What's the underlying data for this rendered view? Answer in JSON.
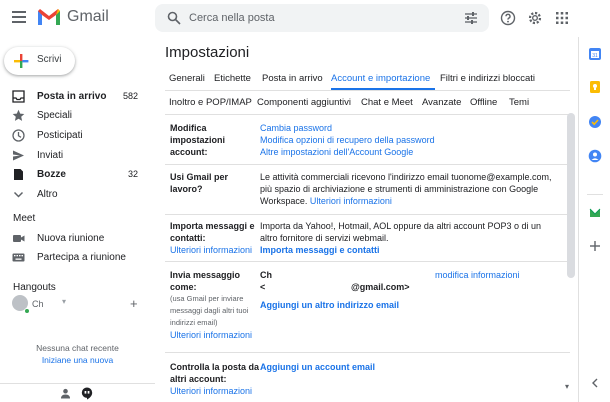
{
  "app": {
    "name": "Gmail",
    "search_placeholder": "Cerca nella posta"
  },
  "sidebar": {
    "compose_label": "Scrivi",
    "items": [
      {
        "label": "Posta in arrivo",
        "count": "582",
        "icon": "inbox-icon",
        "bold": true
      },
      {
        "label": "Speciali",
        "count": "",
        "icon": "star-icon",
        "bold": false
      },
      {
        "label": "Posticipati",
        "count": "",
        "icon": "clock-icon",
        "bold": false
      },
      {
        "label": "Inviati",
        "count": "",
        "icon": "send-icon",
        "bold": false
      },
      {
        "label": "Bozze",
        "count": "32",
        "icon": "draft-icon",
        "bold": true
      },
      {
        "label": "Altro",
        "count": "",
        "icon": "chevron-down-icon",
        "bold": false
      }
    ],
    "meet": {
      "title": "Meet",
      "items": [
        {
          "label": "Nuova riunione",
          "icon": "video-icon"
        },
        {
          "label": "Partecipa a riunione",
          "icon": "keyboard-icon"
        }
      ]
    },
    "hangouts": {
      "title": "Hangouts",
      "user_name": "Ch",
      "no_chat": "Nessuna chat recente",
      "start_new": "Iniziane una nuova"
    }
  },
  "settings": {
    "title": "Impostazioni",
    "tabs_row1": [
      "Generali",
      "Etichette",
      "Posta in arrivo",
      "Account e importazione",
      "Filtri e indirizzi bloccati"
    ],
    "tabs_row2": [
      "Inoltro e POP/IMAP",
      "Componenti aggiuntivi",
      "Chat e Meet",
      "Avanzate",
      "Offline",
      "Temi"
    ],
    "active_tab": "Account e importazione",
    "rows": {
      "change_account": {
        "label": "Modifica impostazioni account:",
        "links": [
          "Cambia password",
          "Modifica opzioni di recupero della password",
          "Altre impostazioni dell'Account Google"
        ]
      },
      "work": {
        "label": "Usi Gmail per lavoro?",
        "text": "Le attività commerciali ricevono l'indirizzo email tuonome@example.com, più spazio di archiviazione e strumenti di amministrazione con Google Workspace.",
        "more": "Ulteriori informazioni"
      },
      "import": {
        "label": "Importa messaggi e contatti:",
        "more": "Ulteriori informazioni",
        "text": "Importa da Yahoo!, Hotmail, AOL oppure da altri account POP3 o di un altro fornitore di servizi webmail.",
        "action": "Importa messaggi e contatti"
      },
      "send_as": {
        "label": "Invia messaggio come:",
        "note": "(usa Gmail per inviare messaggi dagli altri tuoi indirizzi email)",
        "more": "Ulteriori informazioni",
        "name_line": "Ch",
        "email_line": "<",
        "email_domain": "@gmail.com>",
        "edit": "modifica informazioni",
        "add": "Aggiungi un altro indirizzo email"
      },
      "check_mail": {
        "label": "Controlla la posta da altri account:",
        "more": "Ulteriori informazioni",
        "add": "Aggiungi un account email"
      }
    }
  }
}
